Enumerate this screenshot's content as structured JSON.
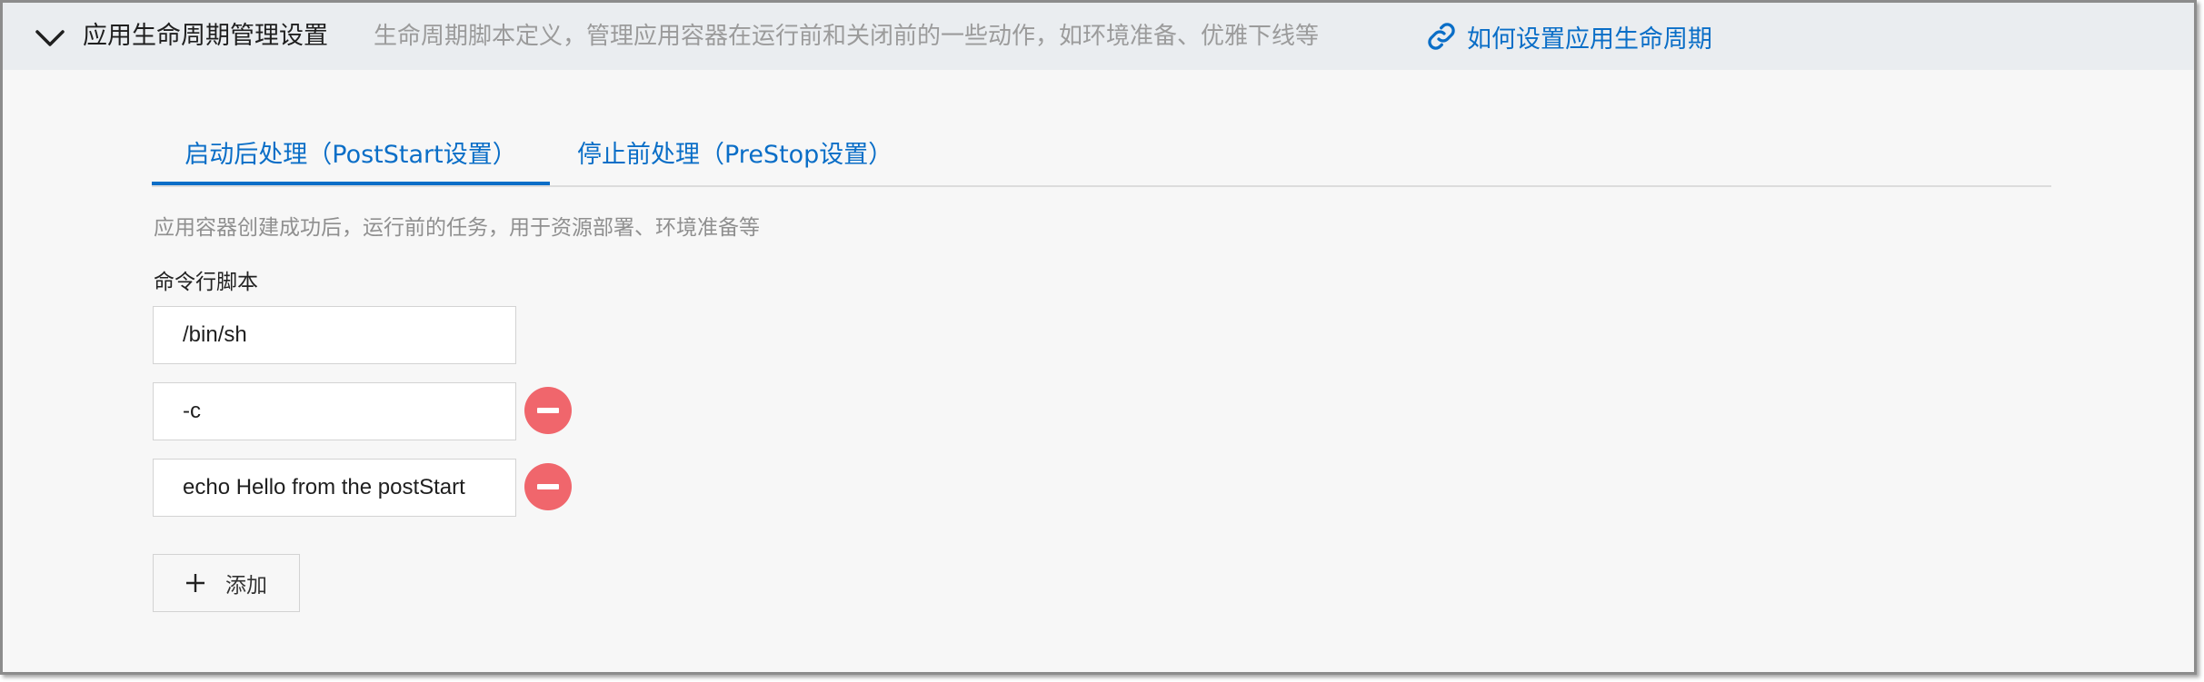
{
  "header": {
    "title": "应用生命周期管理设置",
    "description": "生命周期脚本定义，管理应用容器在运行前和关闭前的一些动作，如环境准备、优雅下线等",
    "help_link": "如何设置应用生命周期",
    "toggle_icon": "chevron-down-icon",
    "link_icon": "link-icon"
  },
  "tabs": [
    {
      "label": "启动后处理（PostStart设置）",
      "active": true
    },
    {
      "label": "停止前处理（PreStop设置）",
      "active": false
    }
  ],
  "tab_description": "应用容器创建成功后，运行前的任务，用于资源部署、环境准备等",
  "command": {
    "label": "命令行脚本",
    "values": [
      "/bin/sh",
      "-c",
      "echo Hello from the postStart"
    ],
    "remove_icon": "minus-circle-icon",
    "add_label": "添加",
    "add_icon": "plus-icon"
  },
  "colors": {
    "accent": "#0a6ec7",
    "remove": "#f0666c",
    "header_bg": "#eaedf0",
    "panel_bg": "#f7f7f7"
  }
}
